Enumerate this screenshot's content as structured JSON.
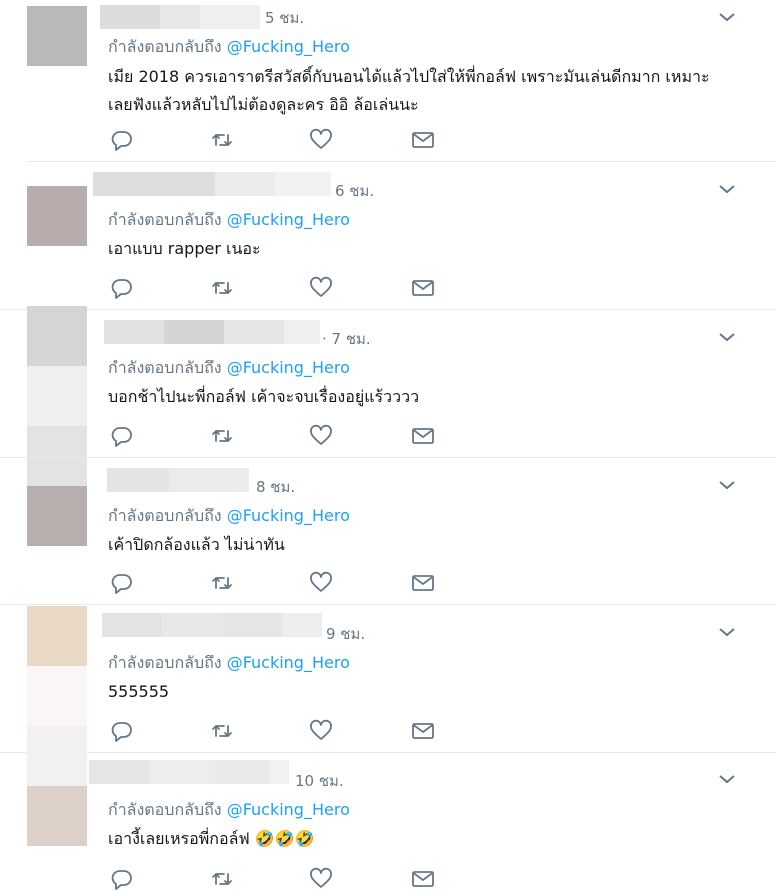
{
  "replying_prefix": "กำลังตอบกลับถึง",
  "reply_handle": "@Fucking_Hero",
  "icons": {
    "more": "chevron-down-icon",
    "reply": "reply-icon",
    "retweet": "retweet-icon",
    "like": "heart-icon",
    "dm": "envelope-icon"
  },
  "colors": {
    "handle": "#1da1f2",
    "meta": "#657786",
    "text": "#14171a",
    "divider": "#e6ecf0"
  },
  "tweets": [
    {
      "time": "5 ชม.",
      "text": "เมีย 2018 ควรเอาราตรีสวัสดิ์กับนอนได้แล้วไปใส่ให้พี่กอล์ฟ เพราะมันเล่นดีกมาก เหมาะเลยฟังแล้วหลับไปไม่ต้องดูละคร อิอิ ล้อเล่นนะ"
    },
    {
      "time": "6 ชม.",
      "text": "เอาแบบ rapper เนอะ"
    },
    {
      "time": "· 7 ชม.",
      "text": "บอกช้าไปนะพี่กอล์ฟ เค้าจะจบเรื่องอยู่แร้วววว"
    },
    {
      "time": "8 ชม.",
      "text": "เค้าปิดกล้องแล้ว ไม่น่าทัน"
    },
    {
      "time": "9 ชม.",
      "text": "555555"
    },
    {
      "time": "10 ชม.",
      "text": "เอางี้เลยเหรอพี่กอล์ฟ 🤣🤣🤣"
    }
  ]
}
